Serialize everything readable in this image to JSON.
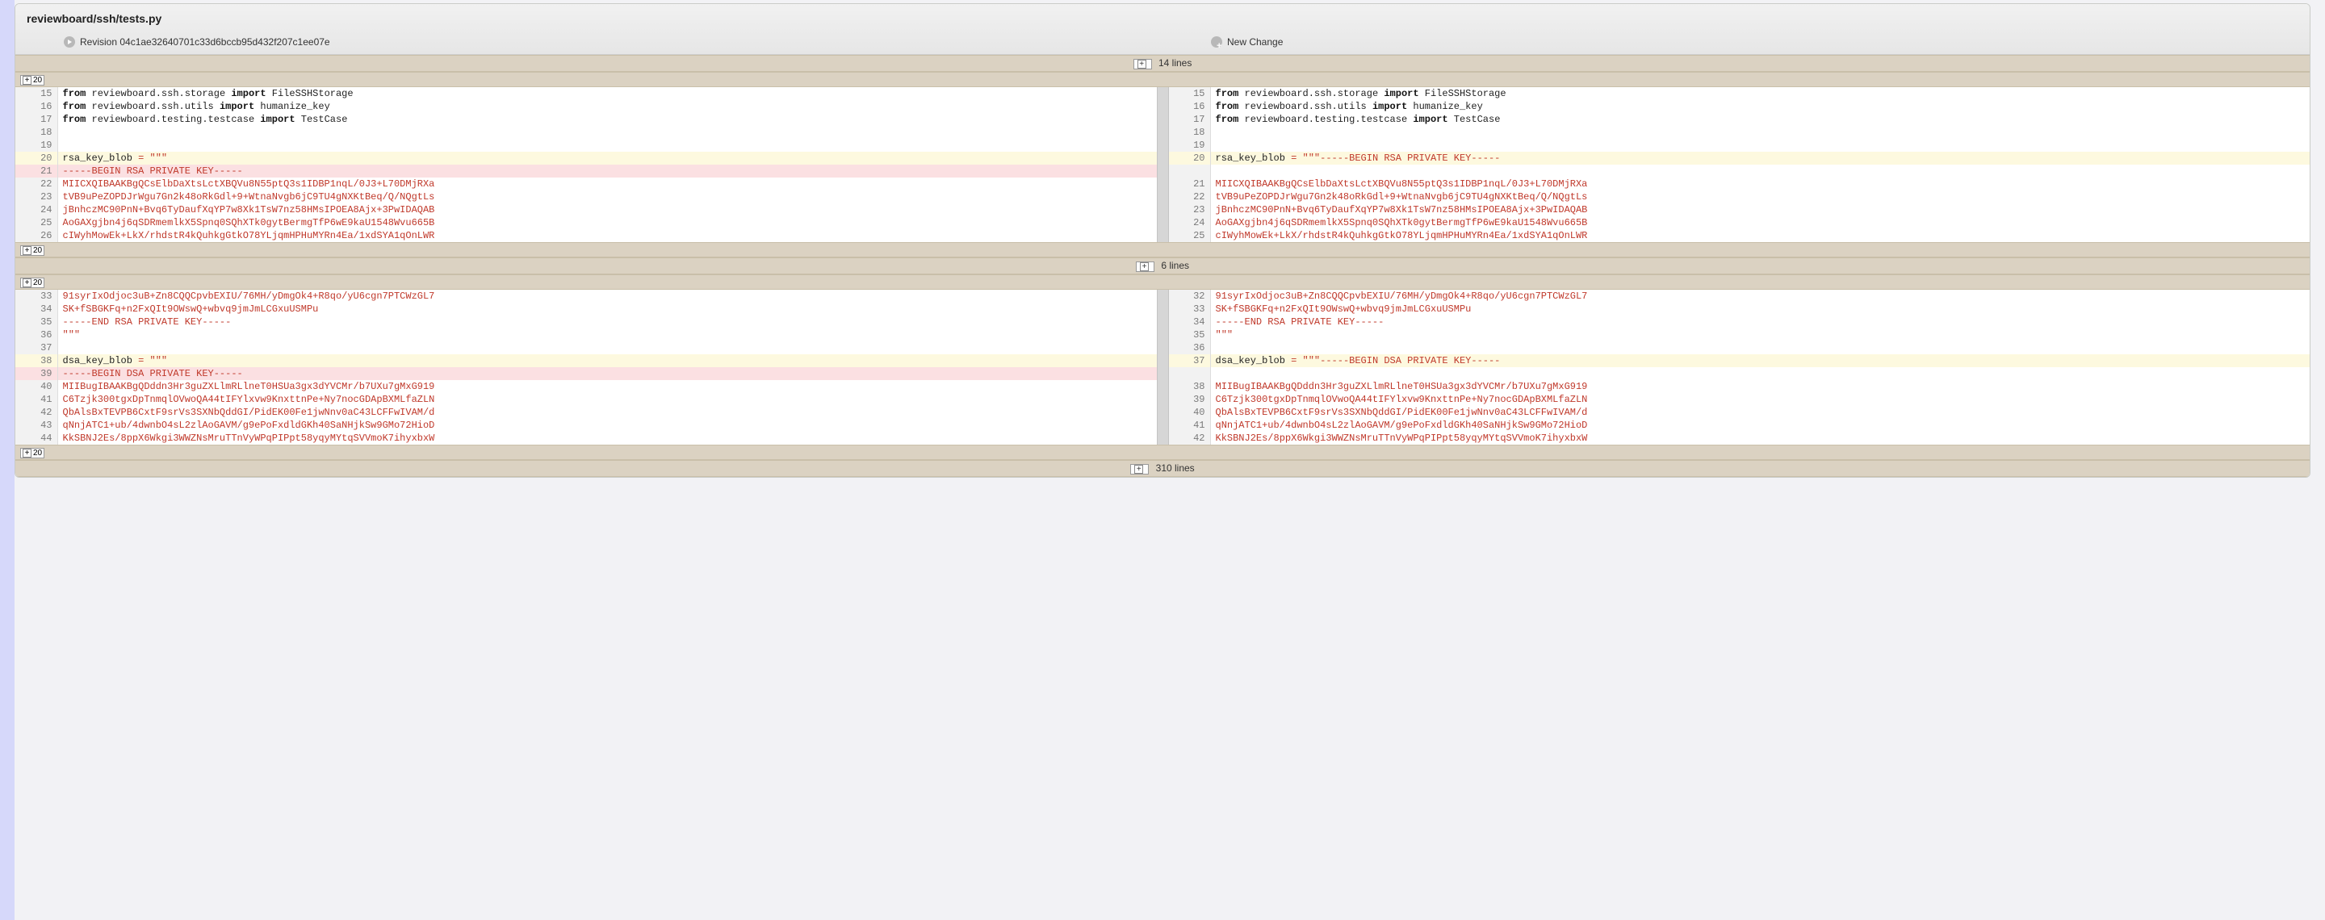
{
  "file_path": "reviewboard/ssh/tests.py",
  "revision_left_label": "Revision 04c1ae32640701c33d6bccb95d432f207c1ee07e",
  "revision_right_label": "New Change",
  "expand_top": {
    "count": "14 lines",
    "btn": "20"
  },
  "expand_mid": {
    "count": "6 lines",
    "btn_top": "20",
    "btn_bot": "20"
  },
  "expand_bot": {
    "count": "310 lines",
    "btn": "20"
  },
  "rows": [
    {
      "type": "same",
      "ln": 15,
      "rn": 15,
      "tokens_l": [
        [
          "kw",
          "from"
        ],
        [
          "plain",
          " reviewboard.ssh.storage "
        ],
        [
          "kw",
          "import"
        ],
        [
          "plain",
          " FileSSHStorage"
        ]
      ],
      "tokens_r": [
        [
          "kw",
          "from"
        ],
        [
          "plain",
          " reviewboard.ssh.storage "
        ],
        [
          "kw",
          "import"
        ],
        [
          "plain",
          " FileSSHStorage"
        ]
      ]
    },
    {
      "type": "same",
      "ln": 16,
      "rn": 16,
      "tokens_l": [
        [
          "kw",
          "from"
        ],
        [
          "plain",
          " reviewboard.ssh.utils "
        ],
        [
          "kw",
          "import"
        ],
        [
          "plain",
          " humanize_key"
        ]
      ],
      "tokens_r": [
        [
          "kw",
          "from"
        ],
        [
          "plain",
          " reviewboard.ssh.utils "
        ],
        [
          "kw",
          "import"
        ],
        [
          "plain",
          " humanize_key"
        ]
      ]
    },
    {
      "type": "same",
      "ln": 17,
      "rn": 17,
      "tokens_l": [
        [
          "kw",
          "from"
        ],
        [
          "plain",
          " reviewboard.testing.testcase "
        ],
        [
          "kw",
          "import"
        ],
        [
          "plain",
          " TestCase"
        ]
      ],
      "tokens_r": [
        [
          "kw",
          "from"
        ],
        [
          "plain",
          " reviewboard.testing.testcase "
        ],
        [
          "kw",
          "import"
        ],
        [
          "plain",
          " TestCase"
        ]
      ]
    },
    {
      "type": "same",
      "ln": 18,
      "rn": 18,
      "tokens_l": [],
      "tokens_r": []
    },
    {
      "type": "same",
      "ln": 19,
      "rn": 19,
      "tokens_l": [],
      "tokens_r": []
    },
    {
      "type": "mod",
      "ln": 20,
      "rn": 20,
      "tokens_l": [
        [
          "plain",
          "rsa_key_blob "
        ],
        [
          "sym",
          "="
        ],
        [
          "plain",
          " "
        ],
        [
          "str",
          "\"\"\""
        ]
      ],
      "tokens_r": [
        [
          "plain",
          "rsa_key_blob "
        ],
        [
          "sym",
          "="
        ],
        [
          "plain",
          " "
        ],
        [
          "str",
          "\"\"\"-----BEGIN RSA PRIVATE KEY-----"
        ]
      ]
    },
    {
      "type": "removed",
      "ln": 21,
      "rn": null,
      "tokens_l": [
        [
          "str",
          "-----BEGIN RSA PRIVATE KEY-----"
        ]
      ],
      "tokens_r": []
    },
    {
      "type": "same",
      "ln": 22,
      "rn": 21,
      "tokens_l": [
        [
          "str",
          "MIICXQIBAAKBgQCsElbDaXtsLctXBQVu8N55ptQ3s1IDBP1nqL/0J3+L70DMjRXa"
        ]
      ],
      "tokens_r": [
        [
          "str",
          "MIICXQIBAAKBgQCsElbDaXtsLctXBQVu8N55ptQ3s1IDBP1nqL/0J3+L70DMjRXa"
        ]
      ]
    },
    {
      "type": "same",
      "ln": 23,
      "rn": 22,
      "tokens_l": [
        [
          "str",
          "tVB9uPeZOPDJrWgu7Gn2k48oRkGdl+9+WtnaNvgb6jC9TU4gNXKtBeq/Q/NQgtLs"
        ]
      ],
      "tokens_r": [
        [
          "str",
          "tVB9uPeZOPDJrWgu7Gn2k48oRkGdl+9+WtnaNvgb6jC9TU4gNXKtBeq/Q/NQgtLs"
        ]
      ]
    },
    {
      "type": "same",
      "ln": 24,
      "rn": 23,
      "tokens_l": [
        [
          "str",
          "jBnhczMC90PnN+Bvq6TyDaufXqYP7w8Xk1TsW7nz58HMsIPOEA8Ajx+3PwIDAQAB"
        ]
      ],
      "tokens_r": [
        [
          "str",
          "jBnhczMC90PnN+Bvq6TyDaufXqYP7w8Xk1TsW7nz58HMsIPOEA8Ajx+3PwIDAQAB"
        ]
      ]
    },
    {
      "type": "same",
      "ln": 25,
      "rn": 24,
      "tokens_l": [
        [
          "str",
          "AoGAXgjbn4j6qSDRmemlkX5Spnq0SQhXTk0gytBermgTfP6wE9kaU1548Wvu665B"
        ]
      ],
      "tokens_r": [
        [
          "str",
          "AoGAXgjbn4j6qSDRmemlkX5Spnq0SQhXTk0gytBermgTfP6wE9kaU1548Wvu665B"
        ]
      ]
    },
    {
      "type": "same",
      "ln": 26,
      "rn": 25,
      "tokens_l": [
        [
          "str",
          "cIWyhMowEk+LkX/rhdstR4kQuhkgGtkO78YLjqmHPHuMYRn4Ea/1xdSYA1qOnLWR"
        ]
      ],
      "tokens_r": [
        [
          "str",
          "cIWyhMowEk+LkX/rhdstR4kQuhkgGtkO78YLjqmHPHuMYRn4Ea/1xdSYA1qOnLWR"
        ]
      ]
    }
  ],
  "rows2": [
    {
      "type": "same",
      "ln": 33,
      "rn": 32,
      "tokens_l": [
        [
          "str",
          "91syrIxOdjoc3uB+Zn8CQQCpvbEXIU/76MH/yDmgOk4+R8qo/yU6cgn7PTCWzGL7"
        ]
      ],
      "tokens_r": [
        [
          "str",
          "91syrIxOdjoc3uB+Zn8CQQCpvbEXIU/76MH/yDmgOk4+R8qo/yU6cgn7PTCWzGL7"
        ]
      ]
    },
    {
      "type": "same",
      "ln": 34,
      "rn": 33,
      "tokens_l": [
        [
          "str",
          "SK+fSBGKFq+n2FxQIt9OWswQ+wbvq9jmJmLCGxuUSMPu"
        ]
      ],
      "tokens_r": [
        [
          "str",
          "SK+fSBGKFq+n2FxQIt9OWswQ+wbvq9jmJmLCGxuUSMPu"
        ]
      ]
    },
    {
      "type": "same",
      "ln": 35,
      "rn": 34,
      "tokens_l": [
        [
          "str",
          "-----END RSA PRIVATE KEY-----"
        ]
      ],
      "tokens_r": [
        [
          "str",
          "-----END RSA PRIVATE KEY-----"
        ]
      ]
    },
    {
      "type": "same",
      "ln": 36,
      "rn": 35,
      "tokens_l": [
        [
          "str",
          "\"\"\""
        ]
      ],
      "tokens_r": [
        [
          "str",
          "\"\"\""
        ]
      ]
    },
    {
      "type": "same",
      "ln": 37,
      "rn": 36,
      "tokens_l": [],
      "tokens_r": []
    },
    {
      "type": "mod",
      "ln": 38,
      "rn": 37,
      "tokens_l": [
        [
          "plain",
          "dsa_key_blob "
        ],
        [
          "sym",
          "="
        ],
        [
          "plain",
          " "
        ],
        [
          "str",
          "\"\"\""
        ]
      ],
      "tokens_r": [
        [
          "plain",
          "dsa_key_blob "
        ],
        [
          "sym",
          "="
        ],
        [
          "plain",
          " "
        ],
        [
          "str",
          "\"\"\"-----BEGIN DSA PRIVATE KEY-----"
        ]
      ]
    },
    {
      "type": "removed",
      "ln": 39,
      "rn": null,
      "tokens_l": [
        [
          "str",
          "-----BEGIN DSA PRIVATE KEY-----"
        ]
      ],
      "tokens_r": []
    },
    {
      "type": "same",
      "ln": 40,
      "rn": 38,
      "tokens_l": [
        [
          "str",
          "MIIBugIBAAKBgQDddn3Hr3guZXLlmRLlneT0HSUa3gx3dYVCMr/b7UXu7gMxG919"
        ]
      ],
      "tokens_r": [
        [
          "str",
          "MIIBugIBAAKBgQDddn3Hr3guZXLlmRLlneT0HSUa3gx3dYVCMr/b7UXu7gMxG919"
        ]
      ]
    },
    {
      "type": "same",
      "ln": 41,
      "rn": 39,
      "tokens_l": [
        [
          "str",
          "C6Tzjk300tgxDpTnmqlOVwoQA44tIFYlxvw9KnxttnPe+Ny7nocGDApBXMLfaZLN"
        ]
      ],
      "tokens_r": [
        [
          "str",
          "C6Tzjk300tgxDpTnmqlOVwoQA44tIFYlxvw9KnxttnPe+Ny7nocGDApBXMLfaZLN"
        ]
      ]
    },
    {
      "type": "same",
      "ln": 42,
      "rn": 40,
      "tokens_l": [
        [
          "str",
          "QbAlsBxTEVPB6CxtF9srVs3SXNbQddGI/PidEK00Fe1jwNnv0aC43LCFFwIVAM/d"
        ]
      ],
      "tokens_r": [
        [
          "str",
          "QbAlsBxTEVPB6CxtF9srVs3SXNbQddGI/PidEK00Fe1jwNnv0aC43LCFFwIVAM/d"
        ]
      ]
    },
    {
      "type": "same",
      "ln": 43,
      "rn": 41,
      "tokens_l": [
        [
          "str",
          "qNnjATC1+ub/4dwnbO4sL2zlAoGAVM/g9ePoFxdldGKh40SaNHjkSw9GMo72HioD"
        ]
      ],
      "tokens_r": [
        [
          "str",
          "qNnjATC1+ub/4dwnbO4sL2zlAoGAVM/g9ePoFxdldGKh40SaNHjkSw9GMo72HioD"
        ]
      ]
    },
    {
      "type": "same",
      "ln": 44,
      "rn": 42,
      "tokens_l": [
        [
          "str",
          "KkSBNJ2Es/8ppX6Wkgi3WWZNsMruTTnVyWPqPIPpt58yqyMYtqSVVmoK7ihyxbxW"
        ]
      ],
      "tokens_r": [
        [
          "str",
          "KkSBNJ2Es/8ppX6Wkgi3WWZNsMruTTnVyWPqPIPpt58yqyMYtqSVVmoK7ihyxbxW"
        ]
      ]
    }
  ]
}
